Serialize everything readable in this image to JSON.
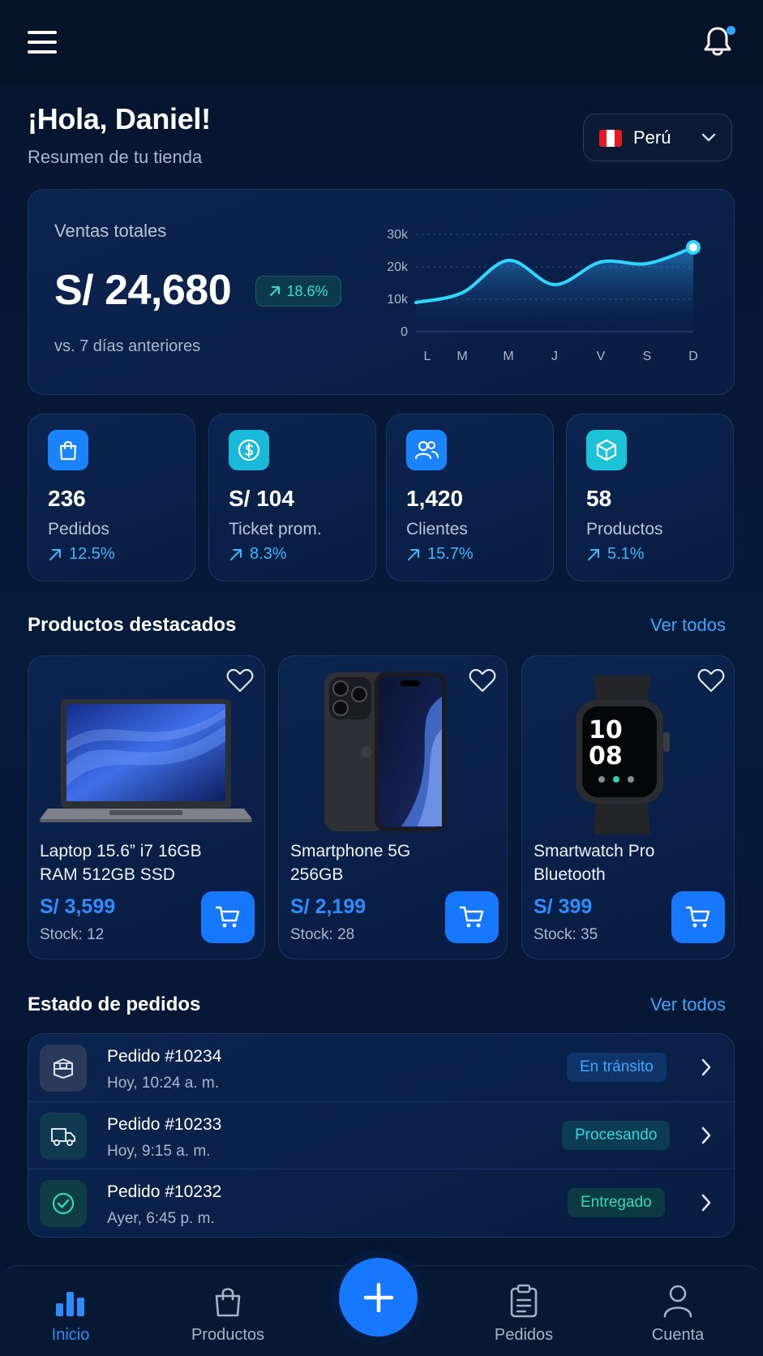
{
  "header": {
    "menu_icon": "menu-icon",
    "bell_icon": "bell-icon",
    "has_notification": true
  },
  "greeting": {
    "title": "¡Hola, Daniel!",
    "subtitle": "Resumen de tu tienda"
  },
  "country_selector": {
    "label": "Perú",
    "flag_colors": [
      "#e31b23",
      "#ffffff",
      "#e31b23"
    ]
  },
  "sales": {
    "label": "Ventas totales",
    "value": "S/ 24,680",
    "change": "18.6%",
    "comparison": "vs. 7 días anteriores",
    "accent_color": "#2fd6ff"
  },
  "chart_data": {
    "type": "area",
    "title": "",
    "xlabel": "",
    "ylabel": "",
    "categories": [
      "L",
      "M",
      "M",
      "J",
      "V",
      "S",
      "D"
    ],
    "values": [
      9000,
      12000,
      22000,
      14500,
      21500,
      21000,
      26000
    ],
    "yticks": [
      "30k",
      "20k",
      "10k",
      "0"
    ],
    "ylim": [
      0,
      30000
    ],
    "grid": "dashed-horizontal",
    "highlight_last_point": true
  },
  "stats": [
    {
      "icon": "shopping-bag-icon",
      "value": "236",
      "label": "Pedidos",
      "change": "12.5%",
      "icon_bg": "#1a84ff"
    },
    {
      "icon": "dollar-icon",
      "value": "S/ 104",
      "label": "Ticket prom.",
      "change": "8.3%",
      "icon_bg": "#18b9d9"
    },
    {
      "icon": "users-icon",
      "value": "1,420",
      "label": "Clientes",
      "change": "15.7%",
      "icon_bg": "#1a84ff"
    },
    {
      "icon": "box-icon",
      "value": "58",
      "label": "Productos",
      "change": "5.1%",
      "icon_bg": "#1cc3d8"
    }
  ],
  "featured": {
    "title": "Productos destacados",
    "link": "Ver todos",
    "products": [
      {
        "name_line1": "Laptop 15.6” i7 16GB",
        "name_line2": "RAM 512GB SSD",
        "price": "S/ 3,599",
        "stock": "Stock: 12",
        "image": "laptop"
      },
      {
        "name_line1": "Smartphone 5G",
        "name_line2": "256GB",
        "price": "S/ 2,199",
        "stock": "Stock: 28",
        "image": "smartphone"
      },
      {
        "name_line1": "Smartwatch Pro",
        "name_line2": "Bluetooth",
        "price": "S/ 399",
        "stock": "Stock: 35",
        "image": "smartwatch",
        "watch_time_h": "10",
        "watch_time_m": "08"
      }
    ]
  },
  "orders": {
    "title": "Estado de pedidos",
    "link": "Ver todos",
    "items": [
      {
        "icon": "package-icon",
        "title": "Pedido #10234",
        "time": "Hoy, 10:24 a. m.",
        "status": "En tránsito",
        "status_color": "#3aa8ff"
      },
      {
        "icon": "truck-icon",
        "title": "Pedido #10233",
        "time": "Hoy, 9:15 a. m.",
        "status": "Procesando",
        "status_color": "#35d3e0"
      },
      {
        "icon": "check-circle-icon",
        "title": "Pedido #10232",
        "time": "Ayer, 6:45 p. m.",
        "status": "Entregado",
        "status_color": "#2fdcb4"
      }
    ]
  },
  "bottom_nav": {
    "items": [
      {
        "label": "Inicio",
        "icon": "bar-chart-icon",
        "active": true
      },
      {
        "label": "Productos",
        "icon": "shopping-bag-icon",
        "active": false
      },
      {
        "label": "Pedidos",
        "icon": "clipboard-icon",
        "active": false
      },
      {
        "label": "Cuenta",
        "icon": "user-icon",
        "active": false
      }
    ],
    "fab_icon": "plus-icon"
  }
}
